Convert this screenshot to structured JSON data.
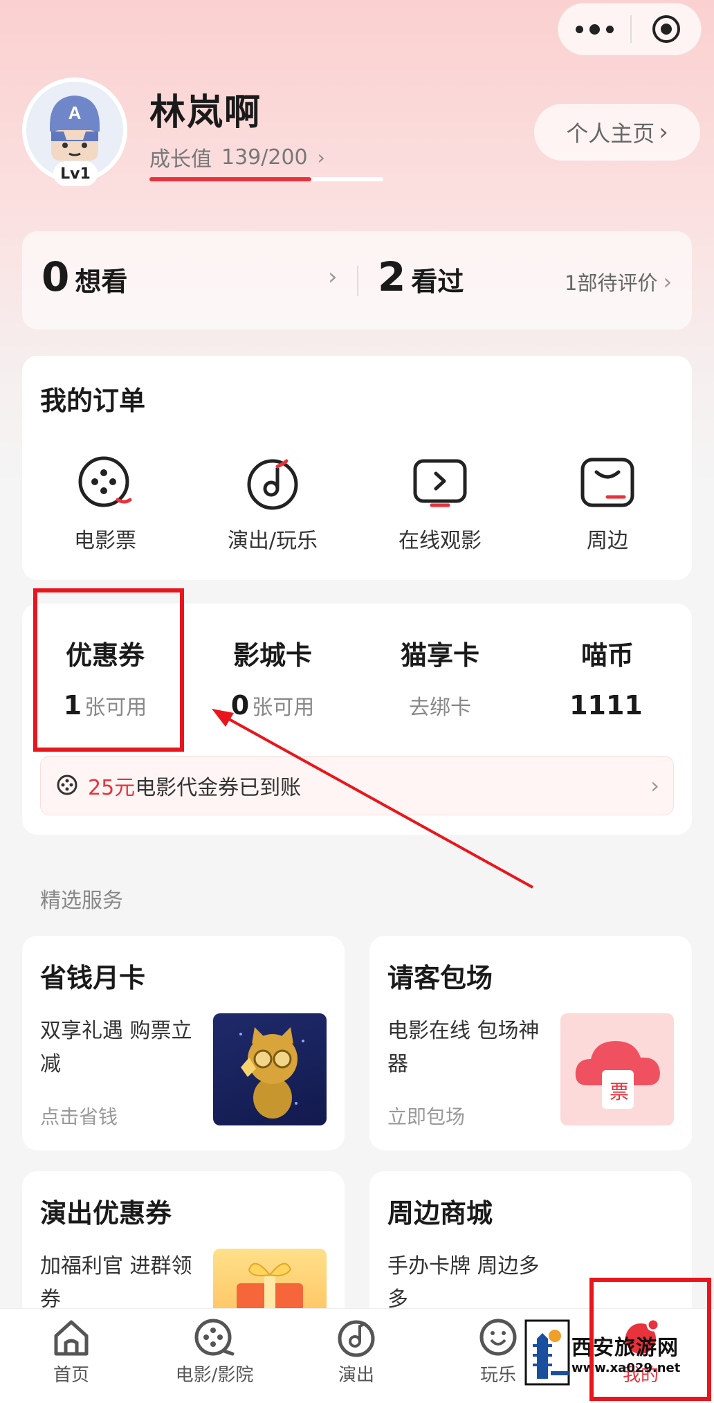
{
  "capsule": {
    "more_icon": "more-dots-icon",
    "close_icon": "target-close-icon"
  },
  "profile": {
    "username": "林岚啊",
    "level": "Lv1",
    "growth_label": "成长值",
    "growth_value": "139/200",
    "growth_progress": 0.695,
    "homepage_label": "个人主页"
  },
  "watch": {
    "want_count": "0",
    "want_label": "想看",
    "seen_count": "2",
    "seen_label": "看过",
    "pending_review": "1部待评价"
  },
  "orders": {
    "title": "我的订单",
    "items": [
      {
        "label": "电影票",
        "icon": "film-reel-icon"
      },
      {
        "label": "演出/玩乐",
        "icon": "music-note-icon"
      },
      {
        "label": "在线观影",
        "icon": "play-screen-icon"
      },
      {
        "label": "周边",
        "icon": "shopping-bag-icon"
      }
    ]
  },
  "wallet": {
    "items": [
      {
        "title": "优惠券",
        "count": "1",
        "sub": "张可用"
      },
      {
        "title": "影城卡",
        "count": "0",
        "sub": "张可用"
      },
      {
        "title": "猫享卡",
        "count": "",
        "sub": "去绑卡"
      },
      {
        "title": "喵币",
        "count": "1111",
        "sub": ""
      }
    ],
    "promo_amount": "25元",
    "promo_text": "电影代金券已到账"
  },
  "services": {
    "section_title": "精选服务",
    "cards": [
      {
        "title": "省钱月卡",
        "desc": "双享礼遇 购票立减",
        "cta": "点击省钱"
      },
      {
        "title": "请客包场",
        "desc": "电影在线 包场神器",
        "cta": "立即包场",
        "badge": "票"
      },
      {
        "title": "演出优惠券",
        "desc": "加福利官 进群领券",
        "cta": ""
      },
      {
        "title": "周边商城",
        "desc": "手办卡牌 周边多多",
        "cta": ""
      }
    ]
  },
  "tabbar": {
    "tabs": [
      {
        "label": "首页",
        "icon": "home-icon"
      },
      {
        "label": "电影/影院",
        "icon": "film-reel-icon"
      },
      {
        "label": "演出",
        "icon": "music-note-icon"
      },
      {
        "label": "玩乐",
        "icon": "smiley-icon"
      },
      {
        "label": "我的",
        "icon": "profile-icon",
        "active": true
      }
    ]
  },
  "watermark": {
    "title": "西安旅游网",
    "url": "www.xa029.net"
  },
  "colors": {
    "accent": "#e8323c",
    "annotation": "#e8161c"
  }
}
